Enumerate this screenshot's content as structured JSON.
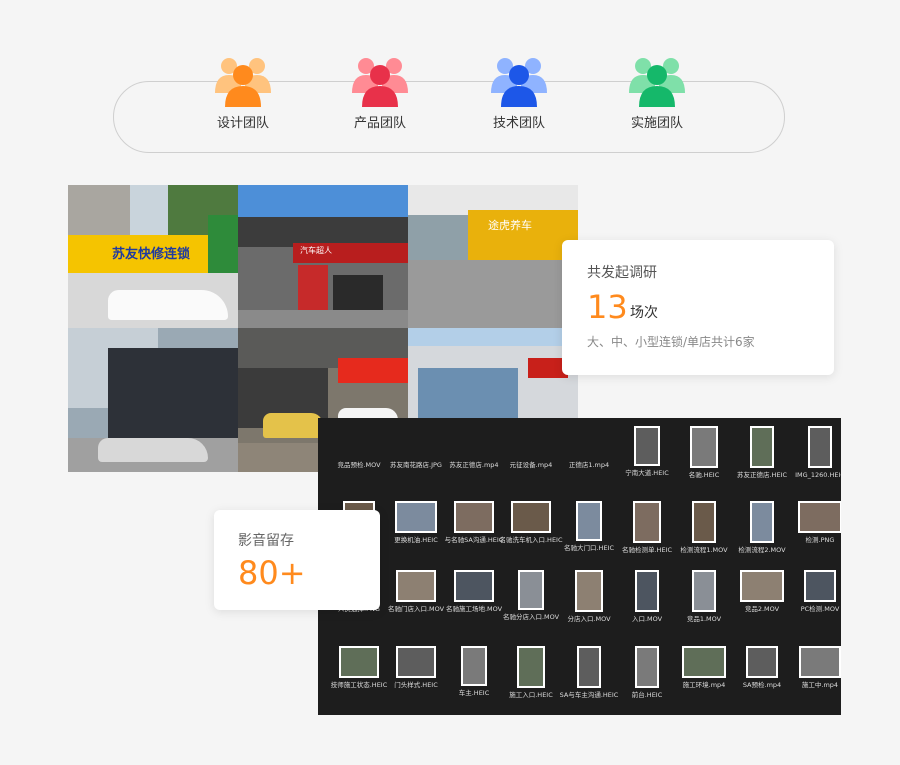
{
  "teams": [
    {
      "label": "设计团队",
      "color": "#ff8a1d",
      "light": "#ffc37e"
    },
    {
      "label": "产品团队",
      "color": "#e8314a",
      "light": "#ff8b94"
    },
    {
      "label": "技术团队",
      "color": "#1d57e8",
      "light": "#8fb3ff"
    },
    {
      "label": "实施团队",
      "color": "#15b86a",
      "light": "#7fe0a9"
    }
  ],
  "research": {
    "title": "共发起调研",
    "count": "13",
    "unit": "场次",
    "subtitle": "大、中、小型连锁/单店共计6家"
  },
  "media": {
    "title": "影音留存",
    "count": "80+"
  },
  "file_rows": [
    [
      "竞品预检.MOV",
      "苏友南花路店.JPG",
      "苏友正德店.mp4",
      "元征设备.mp4",
      "正德店1.mp4",
      "宁南大道.HEIC",
      "名驰.HEIC",
      "苏友正德店.HEIC",
      "IMG_1260.HEIC"
    ],
    [
      "",
      "更换机油.HEIC",
      "与名驰SA沟通.HEIC",
      "名驰洗车机入口.HEIC",
      "名驰大门口.HEIC",
      "名驰检测单.HEIC",
      "检测流程1.MOV",
      "检测流程2.MOV",
      "检测.PNG"
    ],
    [
      "人员选择.PNG",
      "名驰门店入口.MOV",
      "名驰施工场地.MOV",
      "名驰分店入口.MOV",
      "分店入口.MOV",
      "入口.MOV",
      "竞品1.MOV",
      "竞品2.MOV",
      "PC检测.MOV"
    ],
    [
      "技师施工状态.HEIC",
      "门头样式.HEIC",
      "车主.HEIC",
      "施工入口.HEIC",
      "SA与车主沟通.HEIC",
      "前台.HEIC",
      "施工环境.mp4",
      "SA预检.mp4",
      "施工中.mp4"
    ]
  ],
  "photo_signs": [
    "苏友快修连锁",
    "汽车超人",
    "途虎养车",
    "",
    "",
    ""
  ]
}
